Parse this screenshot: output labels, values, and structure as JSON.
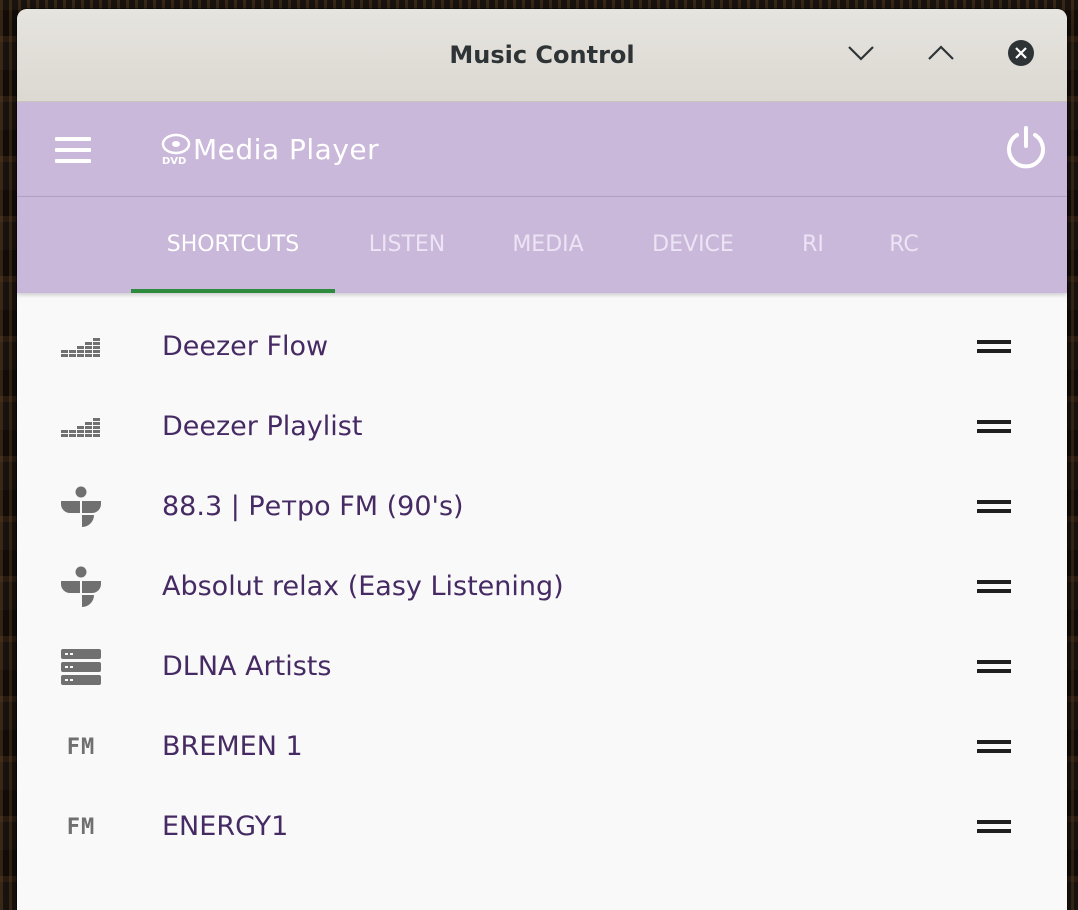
{
  "window": {
    "title": "Music Control"
  },
  "appbar": {
    "title": "Media Player",
    "menu_icon": "hamburger-menu-icon",
    "logo_icon": "dvd-icon",
    "power_icon": "power-icon"
  },
  "tabs": [
    {
      "label": "SHORTCUTS",
      "active": true
    },
    {
      "label": "LISTEN",
      "active": false
    },
    {
      "label": "MEDIA",
      "active": false
    },
    {
      "label": "DEVICE",
      "active": false
    },
    {
      "label": "RI",
      "active": false
    },
    {
      "label": "RC",
      "active": false
    }
  ],
  "shortcuts": [
    {
      "label": "Deezer Flow",
      "icon": "deezer-icon"
    },
    {
      "label": "Deezer Playlist",
      "icon": "deezer-icon"
    },
    {
      "label": "88.3 | Ретро FM (90's)",
      "icon": "tunein-icon"
    },
    {
      "label": "Absolut relax (Easy Listening)",
      "icon": "tunein-icon"
    },
    {
      "label": "DLNA Artists",
      "icon": "server-icon"
    },
    {
      "label": "BREMEN 1",
      "icon": "fm-radio-icon",
      "icon_text": "FM"
    },
    {
      "label": "ENERGY1",
      "icon": "fm-radio-icon",
      "icon_text": "FM"
    }
  ],
  "colors": {
    "accent": "#cab8da",
    "tab_indicator": "#2e8b3e",
    "list_text": "#462a63",
    "icon_gray": "#707070"
  }
}
